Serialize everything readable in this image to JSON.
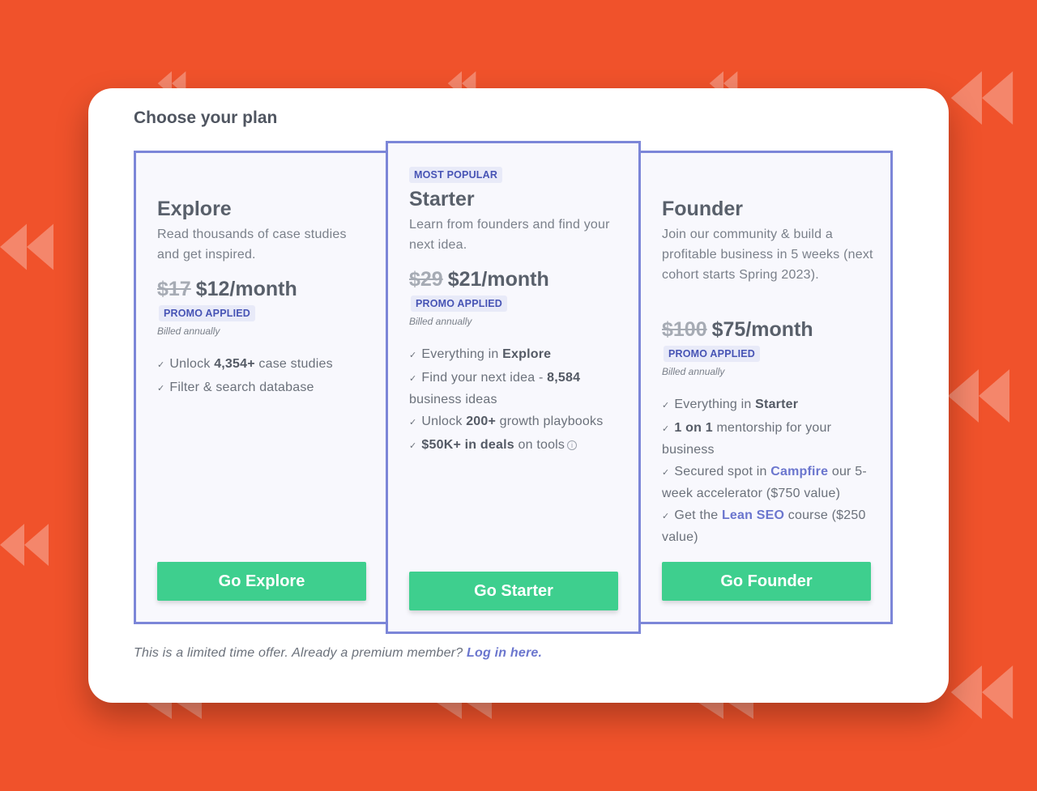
{
  "colors": {
    "background": "#F0522B",
    "card_border": "#7C86D8",
    "cta": "#3ECF8E",
    "accent_link": "#6B76CE",
    "pill_bg": "#E8EAF8",
    "pill_text": "#4754B5"
  },
  "background_icons": [
    "rewind-icon"
  ],
  "modal": {
    "title": "Choose your plan",
    "footer": {
      "text": "This is a limited time offer. Already a premium member?",
      "link": "Log in here."
    }
  },
  "plans": {
    "explore": {
      "name": "Explore",
      "description": "Read thousands of case studies and get inspired.",
      "old_price": "$17",
      "price": "$12/month",
      "promo": "PROMO APPLIED",
      "billed": "Billed annually",
      "features": [
        {
          "pre": "Unlock ",
          "bold": "4,354+",
          "post": " case studies"
        },
        {
          "pre": "Filter & search database",
          "bold": "",
          "post": ""
        }
      ],
      "cta": "Go Explore"
    },
    "starter": {
      "badge": "MOST POPULAR",
      "name": "Starter",
      "description": "Learn from founders and find your next idea.",
      "old_price": "$29",
      "price": "$21/month",
      "promo": "PROMO APPLIED",
      "billed": "Billed annually",
      "features": [
        {
          "pre": "Everything in ",
          "bold": "Explore",
          "post": ""
        },
        {
          "pre": "Find your next idea - ",
          "bold": "8,584",
          "post": " business ideas"
        },
        {
          "pre": "Unlock ",
          "bold": "200+",
          "post": " growth playbooks"
        },
        {
          "pre": "",
          "bold": "$50K+ in deals",
          "post": " on tools"
        }
      ],
      "cta": "Go Starter"
    },
    "founder": {
      "name": "Founder",
      "description": "Join our community & build a profitable business in 5 weeks (next cohort starts Spring 2023).",
      "old_price": "$100",
      "price": "$75/month",
      "promo": "PROMO APPLIED",
      "billed": "Billed annually",
      "features": [
        {
          "pre": "Everything in ",
          "bold": "Starter",
          "post": ""
        },
        {
          "pre": "",
          "bold": "1 on 1",
          "post": " mentorship for your business"
        },
        {
          "pre": "Secured spot in ",
          "link": "Campfire",
          "post": " our 5-week accelerator ($750 value)"
        },
        {
          "pre": "Get the ",
          "link": "Lean SEO",
          "post": " course ($250 value)"
        }
      ],
      "cta": "Go Founder"
    }
  }
}
